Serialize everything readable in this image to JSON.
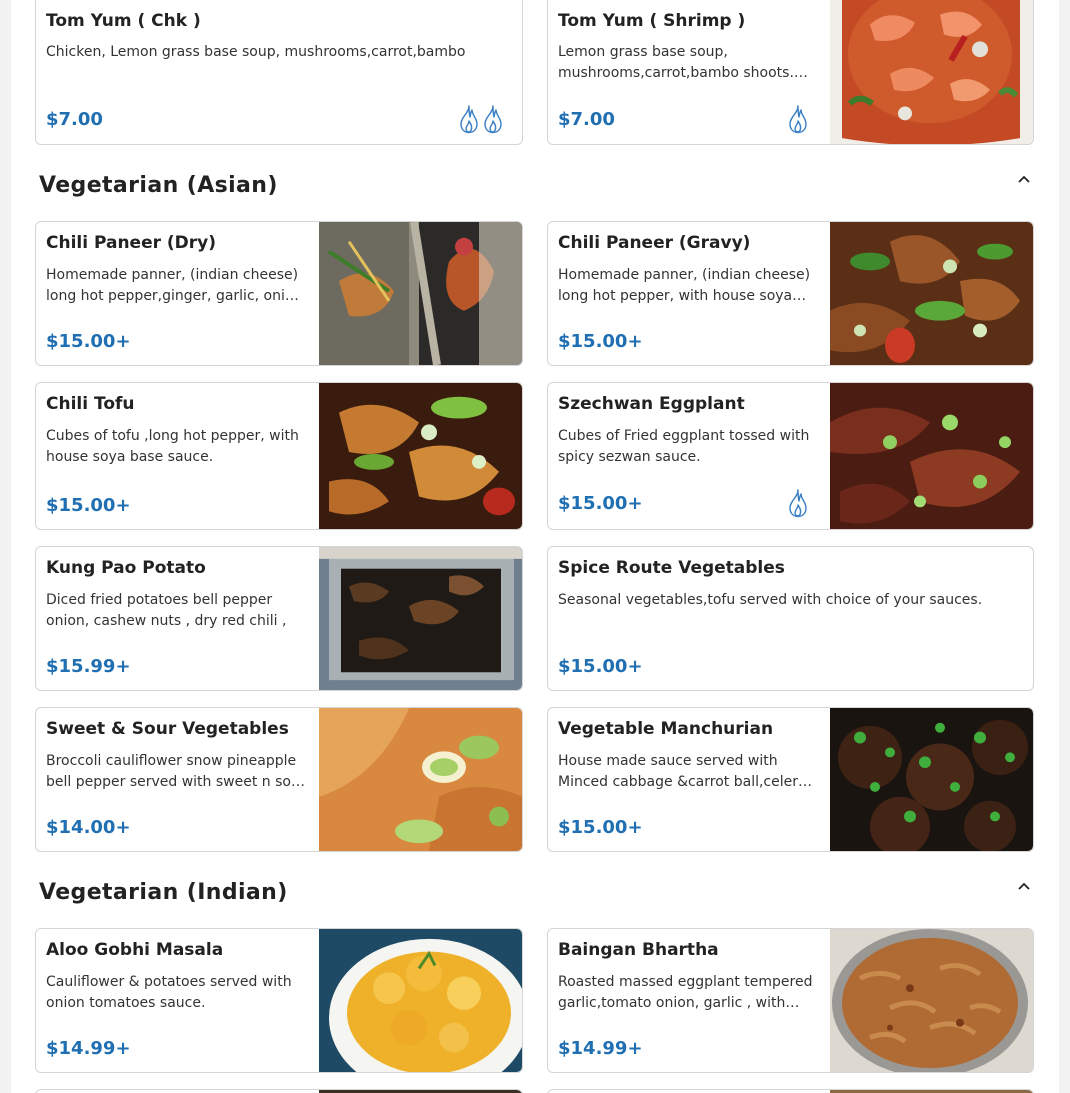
{
  "colors": {
    "price": "#1f6fb2",
    "spice_icon": "#3a7fc4",
    "card_border": "#d5d5d5"
  },
  "top": {
    "items": [
      {
        "name": "Tom Yum ( Chk )",
        "desc": "Chicken, Lemon grass base soup, mushrooms,carrot,bambo",
        "price": "$7.00",
        "spice_level": 2
      },
      {
        "name": "Tom Yum ( Shrimp )",
        "desc": "Lemon grass base soup, mushrooms,carrot,bambo shoots. spicy",
        "price": "$7.00",
        "spice_level": 1
      }
    ]
  },
  "asian": {
    "title": "Vegetarian (Asian)",
    "items": [
      {
        "name": "Chili Paneer (Dry)",
        "desc": "Homemade panner, (indian cheese) long hot pepper,ginger, garlic, onion tossed in house sauce",
        "price": "$15.00+"
      },
      {
        "name": "Chili Paneer (Gravy)",
        "desc": "Homemade panner, (indian cheese) long hot pepper, with house soya base sauce",
        "price": "$15.00+"
      },
      {
        "name": "Chili Tofu",
        "desc": "Cubes of tofu ,long hot pepper, with house soya base sauce.",
        "price": "$15.00+"
      },
      {
        "name": "Szechwan Eggplant",
        "desc": "Cubes of Fried eggplant tossed with spicy sezwan sauce.",
        "price": "$15.00+",
        "spice_level": 1
      },
      {
        "name": "Kung Pao Potato",
        "desc": "Diced fried potatoes bell pepper onion, cashew nuts , dry red chili ,",
        "price": "$15.99+"
      },
      {
        "name": "Spice Route Vegetables",
        "desc": "Seasonal vegetables,tofu served with choice of your sauces.",
        "price": "$15.00+"
      },
      {
        "name": "Sweet & Sour Vegetables",
        "desc": "Broccoli cauliflower snow pineapple bell pepper served with sweet n sour sauce",
        "price": "$14.00+"
      },
      {
        "name": "Vegetable Manchurian",
        "desc": "House made sauce served with Minced cabbage &carrot ball,celery and scallion",
        "price": "$15.00+"
      }
    ]
  },
  "indian": {
    "title": "Vegetarian (Indian)",
    "items": [
      {
        "name": "Aloo Gobhi Masala",
        "desc": "Cauliflower & potatoes served with onion tomatoes sauce.",
        "price": "$14.99+"
      },
      {
        "name": "Baingan Bhartha",
        "desc": "Roasted massed eggplant tempered garlic,tomato onion, garlic , with spices",
        "price": "$14.99+"
      }
    ]
  }
}
